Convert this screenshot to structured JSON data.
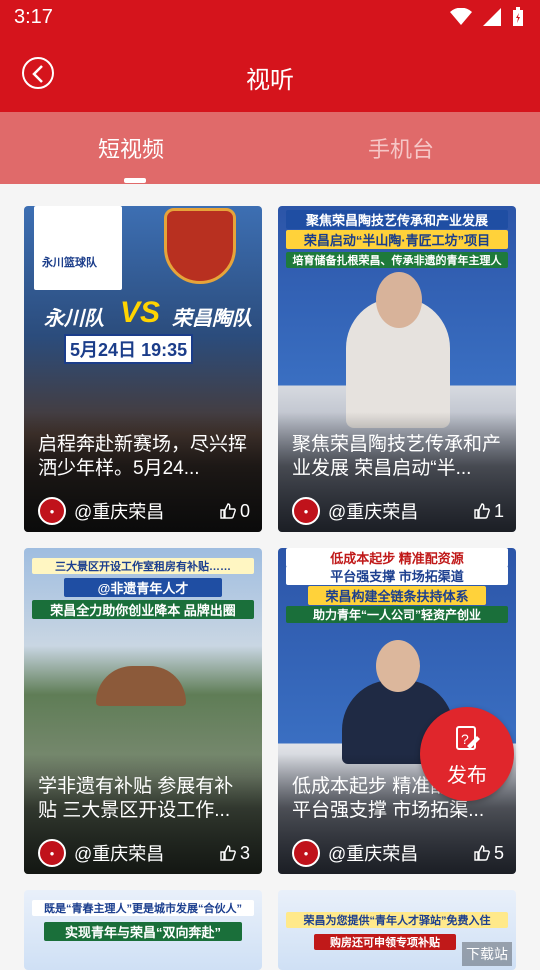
{
  "status": {
    "time": "3:17"
  },
  "header": {
    "title": "视听"
  },
  "tabs": [
    {
      "label": "短视频",
      "active": true
    },
    {
      "label": "手机台",
      "active": false
    }
  ],
  "cards": [
    {
      "caption": "启程奔赴新赛场，尽兴挥洒少年样。5月24...",
      "author": "@重庆荣昌",
      "likes": "0",
      "banners": [
        "永川篮球队",
        "永川队",
        "VS",
        "荣昌陶队",
        "5月24日",
        "19:35"
      ]
    },
    {
      "caption": "聚焦荣昌陶技艺传承和产业发展 荣昌启动“半...",
      "author": "@重庆荣昌",
      "likes": "1",
      "banners": [
        "聚焦荣昌陶技艺传承和产业发展",
        "荣昌启动“半山陶·青匠工坊”项目",
        "培育储备扎根荣昌、传承非遗的青年主理人"
      ]
    },
    {
      "caption": "学非遗有补贴 参展有补贴 三大景区开设工作...",
      "author": "@重庆荣昌",
      "likes": "3",
      "banners": [
        "三大景区开设工作室租房有补贴……",
        "@非遗青年人才",
        "荣昌全力助你创业降本 品牌出圈"
      ]
    },
    {
      "caption": "低成本起步 精准配资源 平台强支撑 市场拓渠...",
      "author": "@重庆荣昌",
      "likes": "5",
      "banners": [
        "低成本起步 精准配资源",
        "平台强支撑 市场拓渠道",
        "荣昌构建全链条扶持体系",
        "助力青年“一人公司”轻资产创业"
      ]
    },
    {
      "caption": "",
      "author": "",
      "likes": "",
      "banners": [
        "既是“青春主理人”更是城市发展“合伙人”",
        "实现青年与荣昌“双向奔赴”"
      ]
    },
    {
      "caption": "",
      "author": "",
      "likes": "",
      "banners": [
        "荣昌为您提供“青年人才驿站”免费入住",
        "购房还可申领专项补贴"
      ]
    }
  ],
  "fab": {
    "label": "发布"
  },
  "watermark": "下载站",
  "colors": {
    "brand": "#d5141c",
    "tab_bar": "#e06a6a",
    "fab": "#e0262c"
  }
}
